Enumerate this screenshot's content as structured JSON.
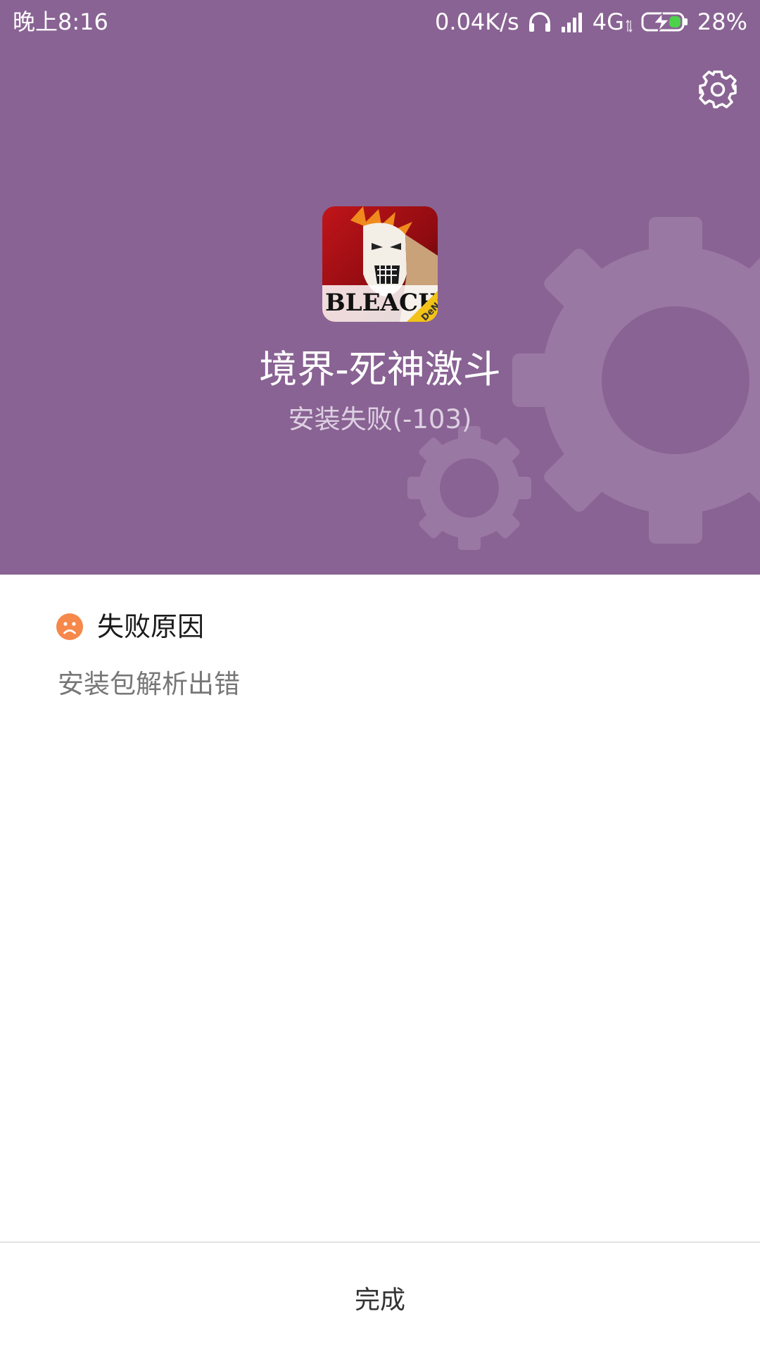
{
  "status_bar": {
    "time": "晚上8:16",
    "network_speed": "0.04K/s",
    "network_type": "4G",
    "battery": "28%",
    "icons": [
      "headphones-icon",
      "signal-icon",
      "data-arrows-icon",
      "battery-charging-icon"
    ]
  },
  "header": {
    "settings_icon": "gear-icon",
    "app_icon": "bleach-game-icon",
    "app_icon_text": "BLEACH",
    "app_icon_badge": "DeNA",
    "app_name": "境界-死神激斗",
    "install_status": "安装失败(-103)",
    "background_color": "#896393"
  },
  "reason": {
    "icon": "sad-face-icon",
    "icon_color": "#f5884a",
    "title": "失败原因",
    "detail": "安装包解析出错"
  },
  "footer": {
    "done_label": "完成"
  }
}
